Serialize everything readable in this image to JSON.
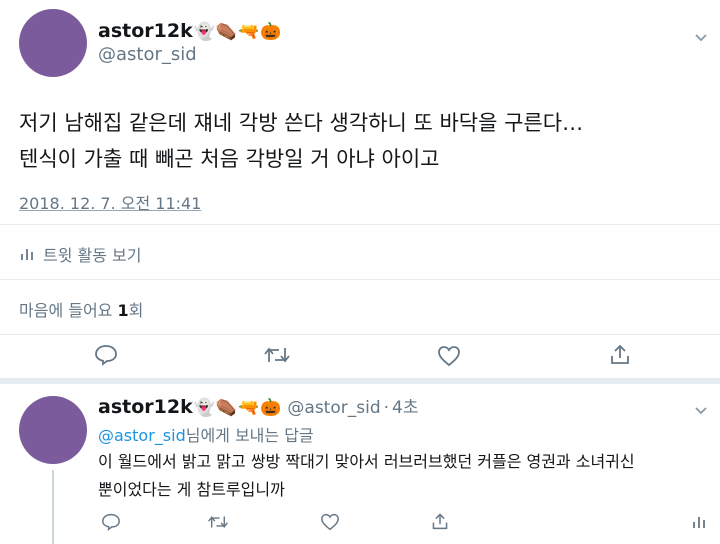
{
  "main_tweet": {
    "display_name": "astor12k",
    "name_emojis": [
      "👻",
      "⚰️",
      "🔫",
      "🎃"
    ],
    "handle": "@astor_sid",
    "text_lines": [
      "저기 남해집 같은데 쟤네 각방 쓴다 생각하니 또 바닥을 구른다…",
      "텐식이 가출 때 빼곤 처음 각방일 거 아냐 아이고"
    ],
    "timestamp": "2018. 12. 7. 오전 11:41",
    "activity_label": "트윗 활동 보기",
    "likes_label": "마음에 들어요",
    "likes_count": "1",
    "likes_unit": "회"
  },
  "reply_tweet": {
    "display_name": "astor12k",
    "name_emojis": [
      "👻",
      "⚰️",
      "🔫",
      "🎃"
    ],
    "handle": "@astor_sid",
    "separator": "·",
    "time_ago": "4초",
    "reply_to_handle": "@astor_sid",
    "reply_to_suffix": "님에게 보내는 답글",
    "text_lines": [
      "이 월드에서 밝고 맑고 쌍방 짝대기 맞아서 러브러브했던 커플은 영권과 소녀귀신",
      "뿐이었다는 게 참트루입니까"
    ]
  },
  "colors": {
    "avatar": "#7b5b9c",
    "text_primary": "#14171a",
    "text_secondary": "#657786",
    "link": "#1b95e0",
    "divider": "#e6ecf0"
  }
}
